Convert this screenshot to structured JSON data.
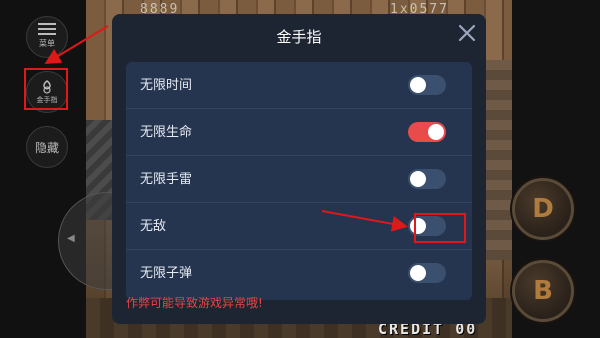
{
  "hud": {
    "top_left": "8889",
    "top_right": "1x0577",
    "credit": "CREDIT 00"
  },
  "side": {
    "menu_label": "菜单",
    "cheat_label": "金手指",
    "hide_label": "隐藏"
  },
  "controls": {
    "d_label": "D",
    "b_label": "B"
  },
  "dialog": {
    "title": "金手指",
    "items": [
      {
        "label": "无限时间",
        "state": "off"
      },
      {
        "label": "无限生命",
        "state": "on"
      },
      {
        "label": "无限手雷",
        "state": "off"
      },
      {
        "label": "无敌",
        "state": "off"
      },
      {
        "label": "无限子弹",
        "state": "off"
      }
    ],
    "warning": "作弊可能导致游戏异常哦!"
  },
  "colors": {
    "dialog_bg": "#1e2532",
    "list_bg": "#25344f",
    "toggle_on": "#e84b4b",
    "toggle_off": "#3b4f6e",
    "warning": "#e84545",
    "highlight": "#e01818"
  }
}
